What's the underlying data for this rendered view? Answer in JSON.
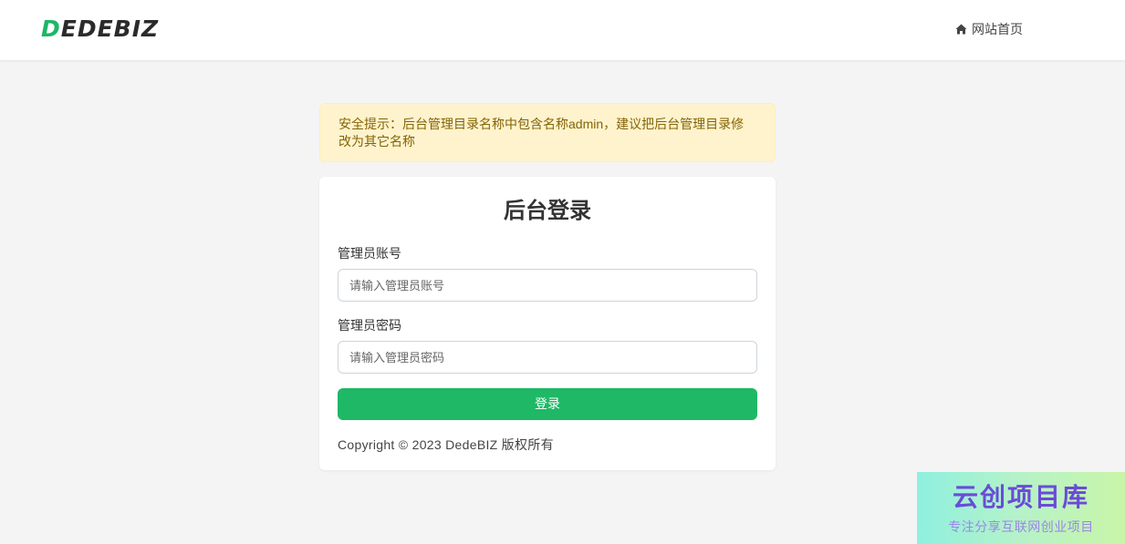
{
  "header": {
    "logo_rest": "EDEBIZ",
    "logo_first": "D",
    "home_label": "网站首页",
    "home_icon": "home-icon"
  },
  "alert": {
    "text": "安全提示：后台管理目录名称中包含名称admin，建议把后台管理目录修改为其它名称"
  },
  "login": {
    "title": "后台登录",
    "username_label": "管理员账号",
    "username_placeholder": "请输入管理员账号",
    "password_label": "管理员密码",
    "password_placeholder": "请输入管理员密码",
    "submit_label": "登录",
    "copyright": "Copyright © 2023 DedeBIZ 版权所有"
  },
  "watermark": {
    "title": "云创项目库",
    "subtitle": "专注分享互联网创业项目"
  },
  "colors": {
    "accent": "#1fb866",
    "alert_bg": "#fff3cd",
    "alert_text": "#856404",
    "page_bg": "#f4f4f4"
  }
}
